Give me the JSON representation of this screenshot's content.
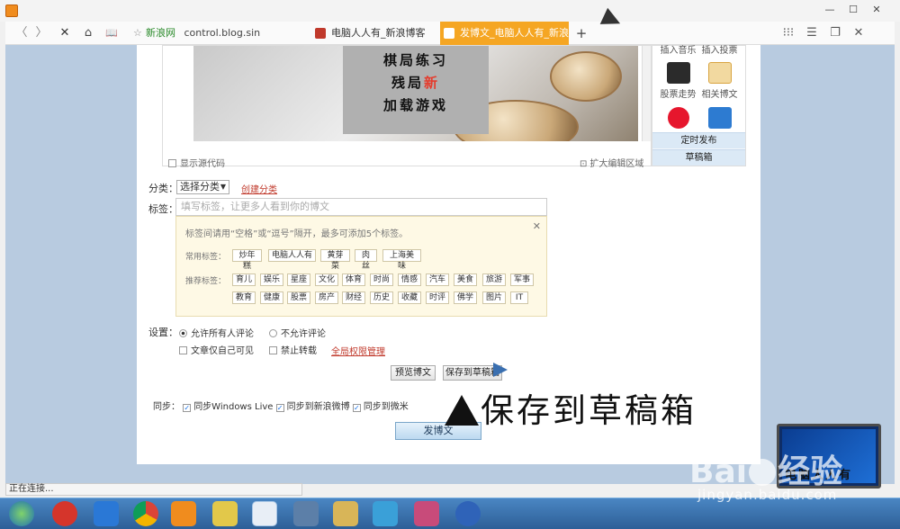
{
  "browser": {
    "window_controls": {
      "minimize": "—",
      "maximize": "☐",
      "close": "✕"
    },
    "nav": {
      "back": "〈",
      "forward": "〉",
      "stop": "✕",
      "home": "⌂",
      "reader": "📖"
    },
    "address": {
      "site_label": "新浪网",
      "url": "control.blog.sin"
    },
    "tabs": [
      {
        "label": "电脑人人有_新浪博客"
      },
      {
        "label": "发博文_电脑人人有_新浪博客"
      }
    ],
    "new_tab": "+",
    "toolbar_right": {
      "grid": "⁝⁝⁝",
      "menu": "☰",
      "restore": "❐",
      "close": "✕"
    }
  },
  "editor": {
    "game_lines": [
      "棋局练习",
      "残局",
      "新",
      "加载游戏"
    ],
    "show_source": "显示源代码",
    "expand": "扩大编辑区域"
  },
  "sidebar": {
    "items": [
      {
        "label": "插入音乐",
        "icon": "music-icon"
      },
      {
        "label": "插入投票",
        "icon": "vote-icon"
      },
      {
        "label": "股票走势",
        "icon": "stock-chart-icon"
      },
      {
        "label": "相关博文",
        "icon": "related-post-icon"
      },
      {
        "label": "",
        "icon": "weibo-icon"
      },
      {
        "label": "",
        "icon": "layout-icon"
      }
    ],
    "scheduled": "定时发布",
    "drafts": "草稿箱"
  },
  "form": {
    "category_label": "分类：",
    "category_value": "选择分类",
    "create_category": "创建分类",
    "tags_label": "标签：",
    "tags_placeholder": "填写标签，让更多人看到你的博文",
    "tag_hint": "标签间请用“空格”或“逗号”隔开，最多可添加5个标签。",
    "common_label": "常用标签：",
    "common_tags": [
      "炒年糕",
      "电脑人人有",
      "黄芽菜",
      "肉丝",
      "上海美味"
    ],
    "recommend_label": "推荐标签：",
    "recommend_row1": [
      "育儿",
      "娱乐",
      "星座",
      "文化",
      "体育",
      "时尚",
      "情感",
      "汽车",
      "美食",
      "旅游",
      "军事"
    ],
    "recommend_row2": [
      "教育",
      "健康",
      "股票",
      "房产",
      "财经",
      "历史",
      "收藏",
      "时评",
      "佛学",
      "图片",
      "IT"
    ],
    "settings_label": "设置：",
    "allow_all_comments": "允许所有人评论",
    "disallow_comments": "不允许评论",
    "self_only": "文章仅自己可见",
    "no_repost": "禁止转载",
    "global_permissions": "全局权限管理",
    "preview": "预览博文",
    "save_draft": "保存到草稿箱",
    "sync_label": "同步：",
    "sync_windows_live": "同步Windows Live",
    "sync_weibo": "同步到新浪微博",
    "sync_weimi": "同步到微米",
    "publish": "发博文"
  },
  "annotation": "保存到草稿箱",
  "status_text": "正在连接...",
  "laptop_text": "电脑人人有",
  "watermark": {
    "brand": "Bai",
    "brand2": "经验",
    "url": "jingyan.baidu.com"
  },
  "colors": {
    "accent_tab": "#f5a623",
    "link": "#c0392b",
    "tag_panel": "#fef9e5"
  }
}
